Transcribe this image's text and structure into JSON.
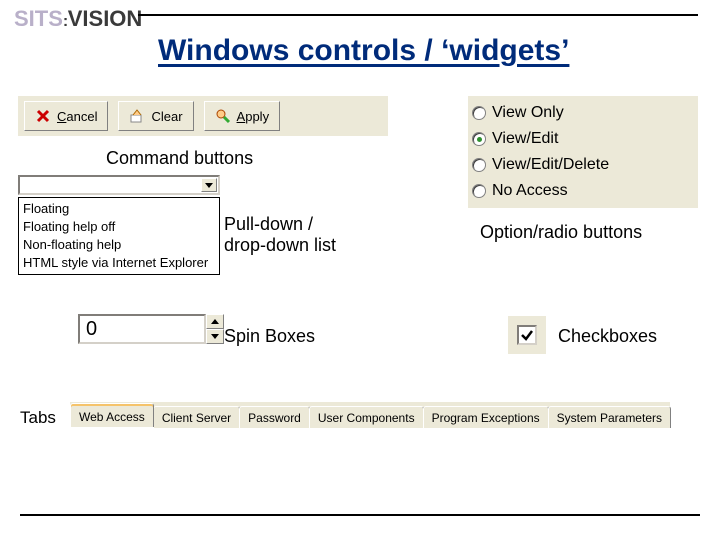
{
  "brand": {
    "left": "SITS",
    "right": "VISION"
  },
  "title": "Windows controls / ‘widgets’",
  "labels": {
    "command_buttons": "Command buttons",
    "pulldown": "Pull-down /\ndrop-down list",
    "spin": "Spin Boxes",
    "radio": "Option/radio buttons",
    "check": "Checkboxes",
    "tabs": "Tabs"
  },
  "command_buttons": [
    {
      "icon": "x-icon",
      "label": "Cancel",
      "underline_first": true
    },
    {
      "icon": "clear-icon",
      "label": "Clear",
      "underline_first": false
    },
    {
      "icon": "apply-icon",
      "label": "Apply",
      "underline_first": true
    }
  ],
  "dropdown": {
    "value": "",
    "options": [
      "Floating",
      "Floating help off",
      "Non-floating help",
      "HTML style via Internet Explorer"
    ]
  },
  "spin": {
    "value": "0"
  },
  "radio": {
    "options": [
      "View Only",
      "View/Edit",
      "View/Edit/Delete",
      "No Access"
    ],
    "selected_index": 1
  },
  "checkbox": {
    "checked": true
  },
  "tabs": {
    "items": [
      "Web Access",
      "Client Server",
      "Password",
      "User Components",
      "Program Exceptions",
      "System Parameters"
    ],
    "active_index": 0
  }
}
